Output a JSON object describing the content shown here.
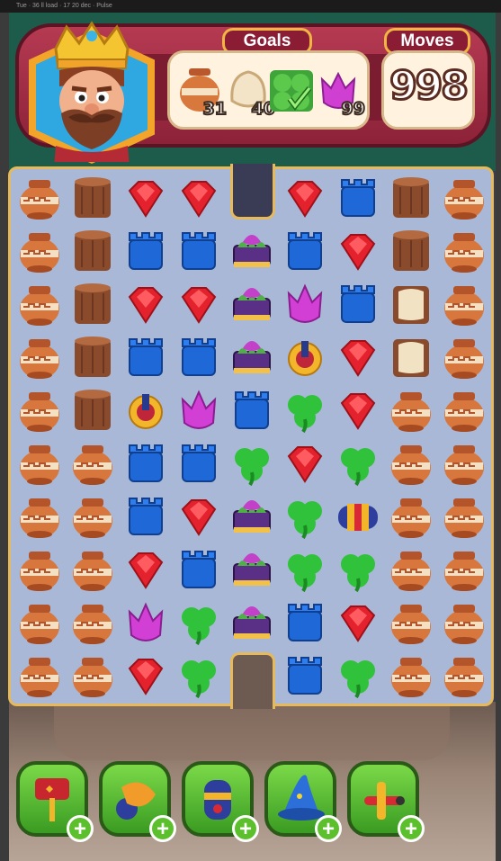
{
  "status_bar": {
    "text": "Tue · 36 ll load · 17 20 dec · Pulse"
  },
  "header": {
    "goals_label": "Goals",
    "moves_label": "Moves",
    "moves_value": "998",
    "goals": [
      {
        "name": "vase",
        "count": "31"
      },
      {
        "name": "bread",
        "count": "40"
      },
      {
        "name": "leaves",
        "count": ""
      },
      {
        "name": "tulip",
        "count": "99"
      }
    ]
  },
  "board": {
    "rows": [
      [
        "vase",
        "log",
        "gem",
        "gem",
        "empty",
        "gem",
        "tower",
        "log",
        "vase"
      ],
      [
        "vase",
        "log",
        "tower",
        "tower",
        "cake",
        "tower",
        "gem",
        "log",
        "vase"
      ],
      [
        "vase",
        "log",
        "gem",
        "gem",
        "cake",
        "tulip",
        "tower",
        "bread",
        "vase"
      ],
      [
        "vase",
        "log",
        "tower",
        "tower",
        "cake",
        "propeller",
        "gem",
        "bread",
        "vase"
      ],
      [
        "vase",
        "log",
        "propeller",
        "tulip",
        "tower",
        "clover",
        "gem",
        "vase",
        "vase"
      ],
      [
        "vase",
        "vase",
        "tower",
        "tower",
        "clover",
        "gem",
        "clover",
        "vase",
        "vase"
      ],
      [
        "vase",
        "vase",
        "tower",
        "gem",
        "cake",
        "clover",
        "rocket",
        "vase",
        "vase"
      ],
      [
        "vase",
        "vase",
        "gem",
        "tower",
        "cake",
        "clover",
        "clover",
        "vase",
        "vase"
      ],
      [
        "vase",
        "vase",
        "tulip",
        "clover",
        "cake",
        "tower",
        "gem",
        "vase",
        "vase"
      ],
      [
        "vase",
        "vase",
        "gem",
        "clover",
        "empty",
        "tower",
        "clover",
        "vase",
        "vase"
      ]
    ]
  },
  "boosters": [
    {
      "name": "hammer",
      "plus": "+"
    },
    {
      "name": "cannon",
      "plus": "+"
    },
    {
      "name": "rocket-booster",
      "plus": "+"
    },
    {
      "name": "wizard-hat",
      "plus": "+"
    },
    {
      "name": "plane",
      "plus": "+"
    }
  ]
}
